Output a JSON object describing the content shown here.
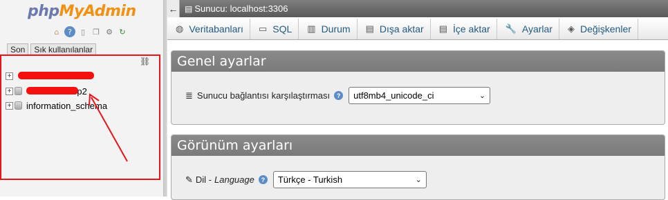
{
  "nav": {
    "logo": {
      "php": "php",
      "my": "My",
      "admin": "Admin"
    },
    "icons": [
      "home-icon",
      "info-icon",
      "docs-icon",
      "copy-icon",
      "gear-icon",
      "reload-icon"
    ],
    "recent_tabs": [
      "Son",
      "Sık kullanılanlar"
    ],
    "tree": [
      {
        "name": "",
        "redacted": true
      },
      {
        "name": "wp2",
        "redacted": true
      },
      {
        "name": "information_schema",
        "redacted": false
      }
    ]
  },
  "server_bar": {
    "back": "←",
    "label": "Sunucu: localhost:3306"
  },
  "tabs": [
    {
      "label": "Veritabanları",
      "icon": "database-icon"
    },
    {
      "label": "SQL",
      "icon": "sql-icon"
    },
    {
      "label": "Durum",
      "icon": "status-icon"
    },
    {
      "label": "Dışa aktar",
      "icon": "export-icon"
    },
    {
      "label": "İçe aktar",
      "icon": "import-icon"
    },
    {
      "label": "Ayarlar",
      "icon": "wrench-icon"
    },
    {
      "label": "Değişkenler",
      "icon": "variables-icon"
    }
  ],
  "general": {
    "title": "Genel ayarlar",
    "collation_label": "Sunucu bağlantısı karşılaştırması",
    "collation_value": "utf8mb4_unicode_ci"
  },
  "view": {
    "title": "Görünüm ayarları",
    "lang_label": "Dil - ",
    "lang_label_en": "Language",
    "lang_value": "Türkçe - Turkish"
  },
  "colors": {
    "accent": "#235a81",
    "annotation": "#e8141a",
    "logo_orange": "#f29111",
    "logo_blue": "#6c78af"
  }
}
